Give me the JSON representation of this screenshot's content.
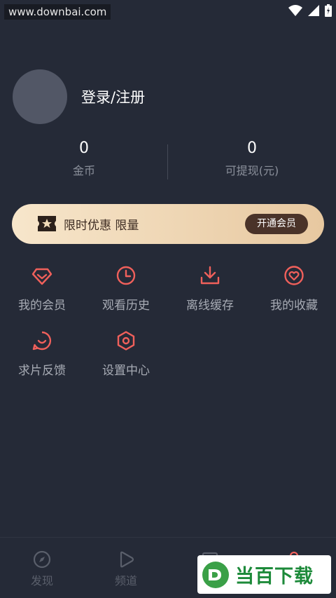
{
  "status_bar": {
    "watermark": "www.downbai.com"
  },
  "profile": {
    "login_text": "登录/注册"
  },
  "stats": [
    {
      "value": "0",
      "label": "金币"
    },
    {
      "value": "0",
      "label": "可提现(元)"
    }
  ],
  "vip_banner": {
    "text": "限时优惠 限量",
    "button": "开通会员"
  },
  "menu": [
    {
      "label": "我的会员",
      "icon": "diamond-icon"
    },
    {
      "label": "观看历史",
      "icon": "clock-icon"
    },
    {
      "label": "离线缓存",
      "icon": "download-icon"
    },
    {
      "label": "我的收藏",
      "icon": "heart-icon"
    },
    {
      "label": "求片反馈",
      "icon": "chat-smile-icon"
    },
    {
      "label": "设置中心",
      "icon": "settings-hexagon-icon"
    }
  ],
  "tabbar": [
    {
      "label": "发现",
      "icon": "compass-icon"
    },
    {
      "label": "频道",
      "icon": "play-icon"
    },
    {
      "label": "",
      "icon": "tv-icon"
    },
    {
      "label": "",
      "icon": "user-icon"
    }
  ],
  "watermark_badge": {
    "text": "当百下载"
  },
  "colors": {
    "background": "#252a37",
    "accent": "#f0605b",
    "vip_gold": "#e7c8a0"
  }
}
